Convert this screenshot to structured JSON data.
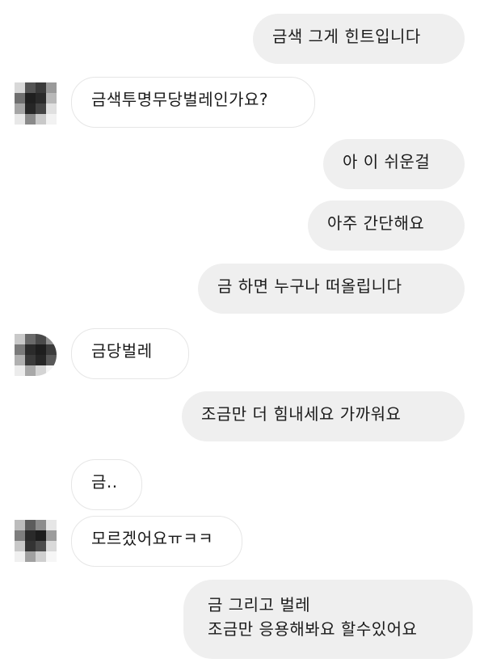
{
  "messages": [
    {
      "side": "sent",
      "text": "금색 그게 힌트입니다"
    },
    {
      "side": "received",
      "text": "금색투명무당벌레인가요?"
    },
    {
      "side": "sent",
      "text": "아 이 쉬운걸"
    },
    {
      "side": "sent",
      "text": "아주 간단해요"
    },
    {
      "side": "sent",
      "text": "금  하면 누구나 떠올립니다"
    },
    {
      "side": "received",
      "text": "금당벌레"
    },
    {
      "side": "sent",
      "text": "조금만 더 힘내세요 가까워요"
    },
    {
      "side": "received",
      "text": "금.."
    },
    {
      "side": "received",
      "text": "모르겠어요ㅠㅋㅋ"
    },
    {
      "side": "sent",
      "lines": [
        "금 그리고 벌레",
        "조금만 응용해봐요 할수있어요"
      ]
    }
  ],
  "avatar": {
    "description_icon": "pixelated-avatar-icon",
    "palette": [
      "#1c1c1c",
      "#3b3b3b",
      "#5a5a5a",
      "#7d7d7d",
      "#9e9e9e",
      "#c4c4c4",
      "#e2e2e2"
    ]
  }
}
